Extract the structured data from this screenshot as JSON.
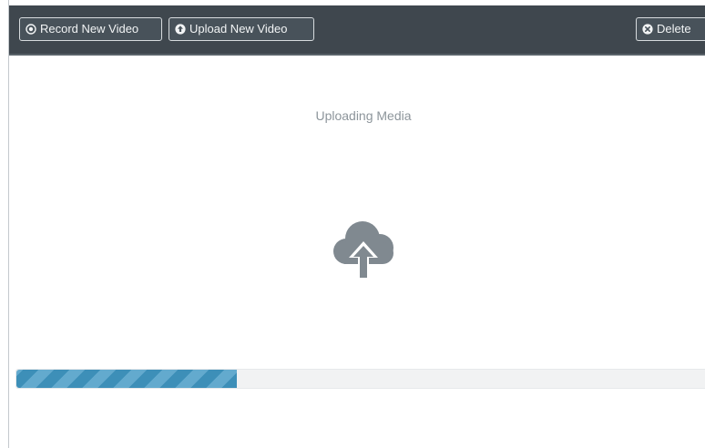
{
  "toolbar": {
    "record_label": "Record New Video",
    "record_icon": "record-circle-icon",
    "upload_label": "Upload New Video",
    "upload_icon": "upload-arrow-circle-icon",
    "delete_label": "Delete",
    "delete_icon": "close-circle-icon"
  },
  "main": {
    "status_text": "Uploading Media",
    "status_icon": "cloud-upload-icon"
  },
  "progress": {
    "percent": 32
  },
  "colors": {
    "toolbar_bg": "#3f474e",
    "progress_fill": "#3d8fb8",
    "progress_stripe": "#63aace",
    "icon_gray": "#808990"
  }
}
